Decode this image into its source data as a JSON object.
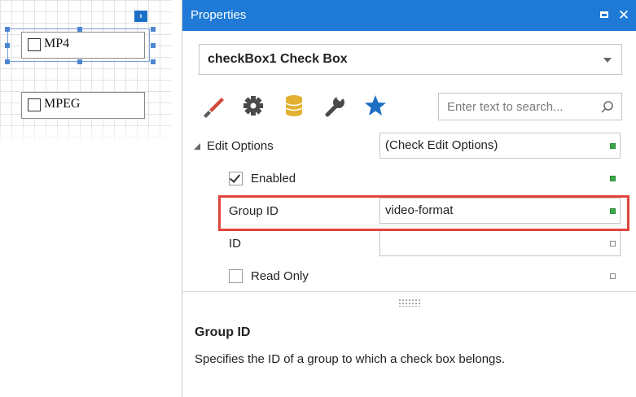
{
  "designer": {
    "checkbox1_label": "MP4",
    "checkbox2_label": "MPEG"
  },
  "panel": {
    "title": "Properties",
    "selected_object": "checkBox1   Check Box",
    "search_placeholder": "Enter text to search...",
    "tab_icons": [
      "appearance-brush-icon",
      "behavior-gear-icon",
      "data-database-icon",
      "tools-wrench-icon",
      "favorites-star-icon"
    ],
    "accent_color": "#1e7ad6"
  },
  "properties": {
    "edit_options": {
      "name": "Edit Options",
      "value": "(Check Edit Options)"
    },
    "enabled": {
      "name": "Enabled",
      "checked": true
    },
    "group_id": {
      "name": "Group ID",
      "value": "video-format"
    },
    "id": {
      "name": "ID",
      "value": ""
    },
    "read_only": {
      "name": "Read Only",
      "checked": false
    }
  },
  "description": {
    "title": "Group ID",
    "text": "Specifies the ID of a group to which a check box belongs."
  },
  "highlight_color": "#e0443e"
}
